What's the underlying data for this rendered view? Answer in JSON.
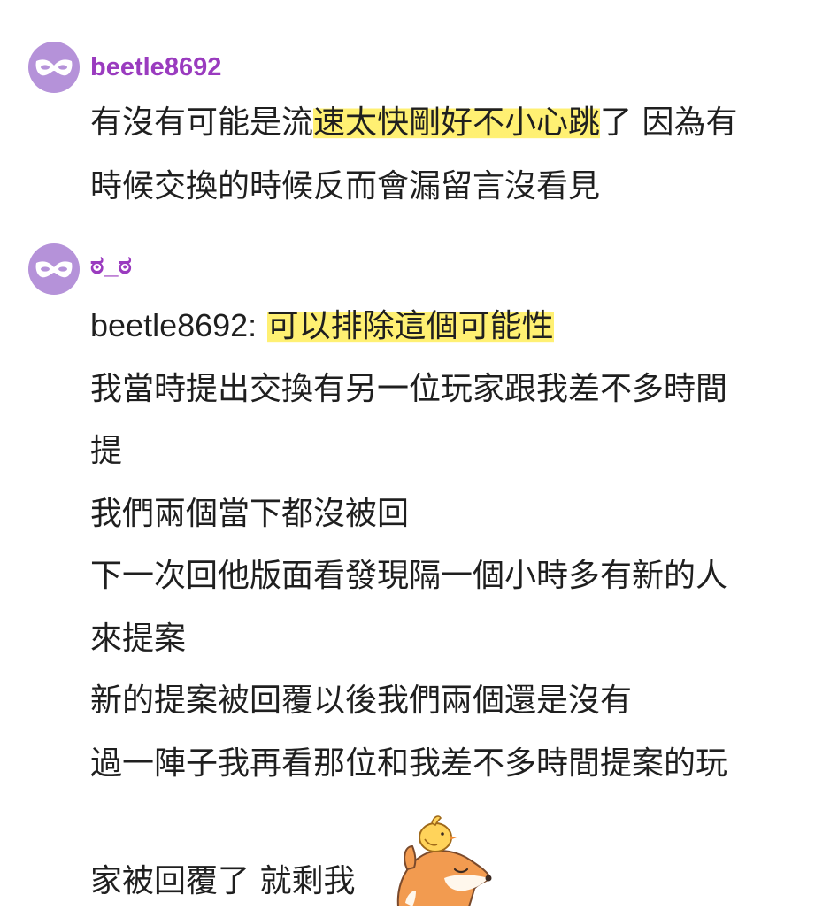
{
  "comments": [
    {
      "username": "beetle8692",
      "avatar_icon": "mask-icon",
      "lines": [
        {
          "before": "有沒有可能是流",
          "highlight": "速太快剛好不小心跳",
          "after": "了 因為有"
        },
        {
          "text": "時候交換的時候反而會漏留言沒看見"
        }
      ]
    },
    {
      "username": "ಠ_ಠ",
      "avatar_icon": "mask-icon",
      "mention": "beetle8692:",
      "mention_highlight": "可以排除這個可能性",
      "lines": [
        "我當時提出交換有另一位玩家跟我差不多時間",
        "提",
        "我們兩個當下都沒被回",
        "下一次回他版面看發現隔一個小時多有新的人",
        "來提案",
        "新的提案被回覆以後我們兩個還是沒有",
        "過一陣子我再看那位和我差不多時間提案的玩",
        "家被回覆了 就剩我"
      ],
      "sticker": "fox-with-chick-sticker"
    }
  ],
  "colors": {
    "avatar_bg": "#b592d9",
    "username": "#9a3bbf",
    "highlight": "#ffee5a",
    "text": "#1f1f1f"
  }
}
